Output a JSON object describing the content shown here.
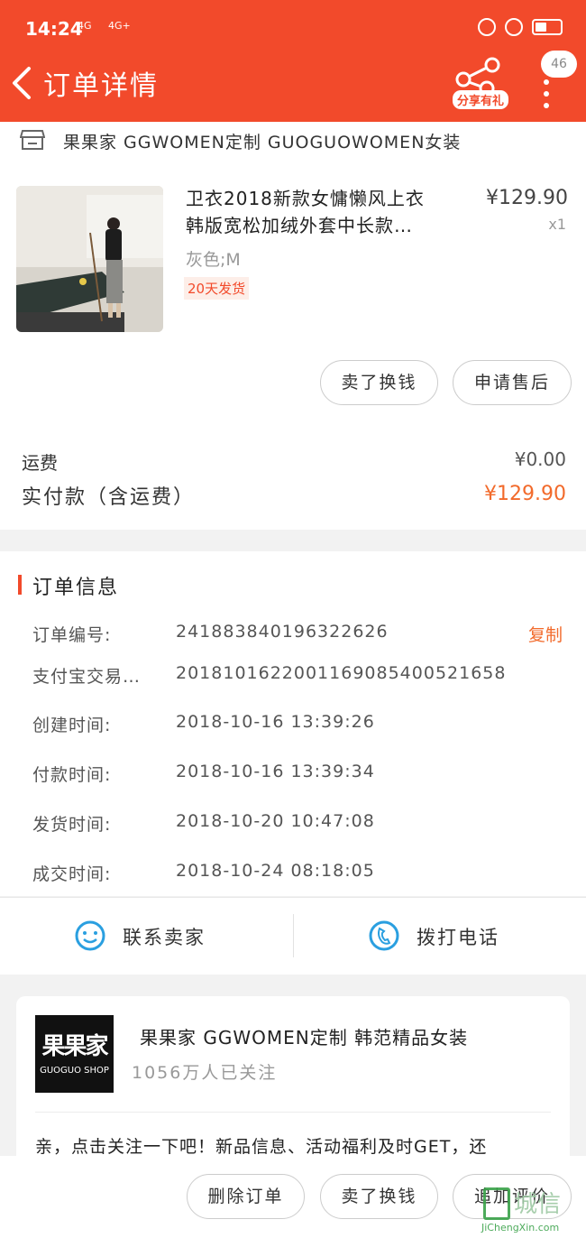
{
  "status_bar": {
    "time": "14:24",
    "signal1": "4G",
    "signal2": "4G+"
  },
  "header": {
    "title": "订单详情",
    "share_label": "分享有礼",
    "badge_count": "46"
  },
  "shop": {
    "name": "果果家 GGWOMEN定制 GUOGUOWOMEN女装"
  },
  "product": {
    "name_line1": "卫衣2018新款女慵懒风上衣",
    "name_line2": "韩版宽松加绒外套中长款…",
    "price": "¥129.90",
    "quantity": "x1",
    "sku": "灰色;M",
    "ship_tag": "20天发货",
    "buttons": {
      "sell_label": "卖了换钱",
      "after_sale_label": "申请售后"
    }
  },
  "payment": {
    "shipping_label": "运费",
    "shipping_value": "¥0.00",
    "paid_label": "实付款（含运费）",
    "paid_value": "¥129.90"
  },
  "order_info": {
    "title": "订单信息",
    "copy_label": "复制",
    "rows": [
      {
        "key": "订单编号:",
        "value": "241883840196322626"
      },
      {
        "key": "支付宝交易…",
        "value": "2018101622001169085400521658"
      },
      {
        "key": "创建时间:",
        "value": "2018-10-16 13:39:26"
      },
      {
        "key": "付款时间:",
        "value": "2018-10-16 13:39:34"
      },
      {
        "key": "发货时间:",
        "value": "2018-10-20 10:47:08"
      },
      {
        "key": "成交时间:",
        "value": "2018-10-24 08:18:05"
      }
    ]
  },
  "contact": {
    "seller_label": "联系卖家",
    "phone_label": "拨打电话"
  },
  "shop_card": {
    "logo_cn": "果果家",
    "logo_en": "GUOGUO SHOP",
    "name": "果果家 GGWOMEN定制 韩范精品女装",
    "fans": "1056万人已关注",
    "message": "亲，点击关注一下吧！新品信息、活动福利及时GET，还"
  },
  "bottom_bar": {
    "delete_label": "删除订单",
    "sell_label": "卖了换钱",
    "review_label": "追加评价"
  },
  "watermark": {
    "text": "城信",
    "url": "JiChengXin.com"
  },
  "colors": {
    "brand": "#f24a2b",
    "price_accent": "#f26a2b",
    "contact_icon": "#2a9fe0"
  }
}
